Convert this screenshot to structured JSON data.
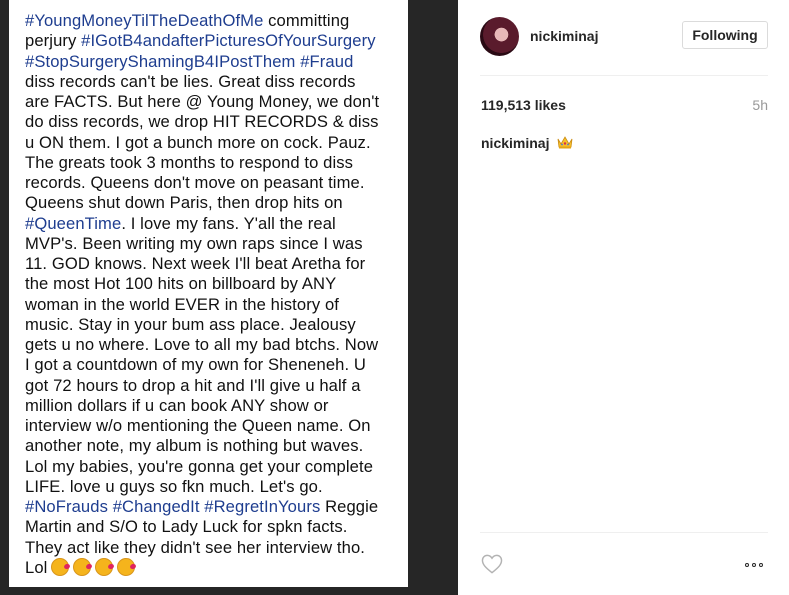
{
  "post_image": {
    "lines": [
      [
        {
          "t": "#YoungMoneyTilTheDeathOfMe",
          "tag": true
        },
        {
          "t": " committing",
          "tag": false
        }
      ],
      [
        {
          "t": "perjury ",
          "tag": false
        },
        {
          "t": "#IGotB4andafterPicturesOfYourSurgery",
          "tag": true
        }
      ],
      [
        {
          "t": "#StopSurgeryShamingB4IPostThem",
          "tag": true
        },
        {
          "t": " ",
          "tag": false
        },
        {
          "t": "#Fraud",
          "tag": true
        }
      ],
      [
        {
          "t": "diss records can't be lies. Great diss records",
          "tag": false
        }
      ],
      [
        {
          "t": "are FACTS. But here @ Young Money, we don't",
          "tag": false
        }
      ],
      [
        {
          "t": "do diss records, we drop HIT RECORDS & diss",
          "tag": false
        }
      ],
      [
        {
          "t": "u ON them. I got a bunch more on cock. Pauz.",
          "tag": false
        }
      ],
      [
        {
          "t": "The greats took 3 months to respond to diss",
          "tag": false
        }
      ],
      [
        {
          "t": "records. Queens don't move on peasant time.",
          "tag": false
        }
      ],
      [
        {
          "t": "Queens shut down Paris, then drop hits on",
          "tag": false
        }
      ],
      [
        {
          "t": "#QueenTime",
          "tag": true
        },
        {
          "t": ". I love my fans. Y'all the real",
          "tag": false
        }
      ],
      [
        {
          "t": "MVP's. Been writing my own raps since I was",
          "tag": false
        }
      ],
      [
        {
          "t": "11. GOD knows. Next week I'll beat Aretha for",
          "tag": false
        }
      ],
      [
        {
          "t": "the most Hot 100 hits on billboard by ANY",
          "tag": false
        }
      ],
      [
        {
          "t": "woman in the world EVER in the history of",
          "tag": false
        }
      ],
      [
        {
          "t": "music. Stay in your bum ass place. Jealousy",
          "tag": false
        }
      ],
      [
        {
          "t": "gets u no where. Love to all my bad btchs. Now",
          "tag": false
        }
      ],
      [
        {
          "t": "I got a countdown of my own for Sheneneh. U",
          "tag": false
        }
      ],
      [
        {
          "t": "got 72 hours to drop a hit and I'll give u half a",
          "tag": false
        }
      ],
      [
        {
          "t": "million dollars if u can book ANY show or",
          "tag": false
        }
      ],
      [
        {
          "t": "interview w/o mentioning the Queen name. On",
          "tag": false
        }
      ],
      [
        {
          "t": "another note, my album is nothing but waves.",
          "tag": false
        }
      ],
      [
        {
          "t": "Lol my babies, you're gonna get your complete",
          "tag": false
        }
      ],
      [
        {
          "t": "LIFE. love u guys so fkn much. Let's go.",
          "tag": false
        }
      ],
      [
        {
          "t": "#NoFrauds",
          "tag": true
        },
        {
          "t": " ",
          "tag": false
        },
        {
          "t": "#ChangedIt",
          "tag": true
        },
        {
          "t": " ",
          "tag": false
        },
        {
          "t": "#RegretInYours",
          "tag": true
        },
        {
          "t": " Reggie",
          "tag": false
        }
      ],
      [
        {
          "t": "Martin and S/O to Lady Luck for spkn facts.",
          "tag": false
        }
      ],
      [
        {
          "t": "They act like they didn't see her interview tho.",
          "tag": false
        }
      ],
      [
        {
          "t": "Lol",
          "tag": false
        }
      ]
    ],
    "final_emoji_count": 4,
    "final_emoji_name": "kissing-face-emoji"
  },
  "header": {
    "username": "nickiminaj",
    "follow_label": "Following"
  },
  "stats": {
    "likes": "119,513 likes",
    "time_ago": "5h"
  },
  "caption": {
    "username": "nickiminaj",
    "emoji": "crown-emoji"
  },
  "actions": {
    "like_icon": "heart-outline-icon",
    "more_icon": "more-options-icon"
  },
  "colors": {
    "hashtag": "#1e3d8f",
    "backdrop": "#262626",
    "muted": "#999999"
  }
}
